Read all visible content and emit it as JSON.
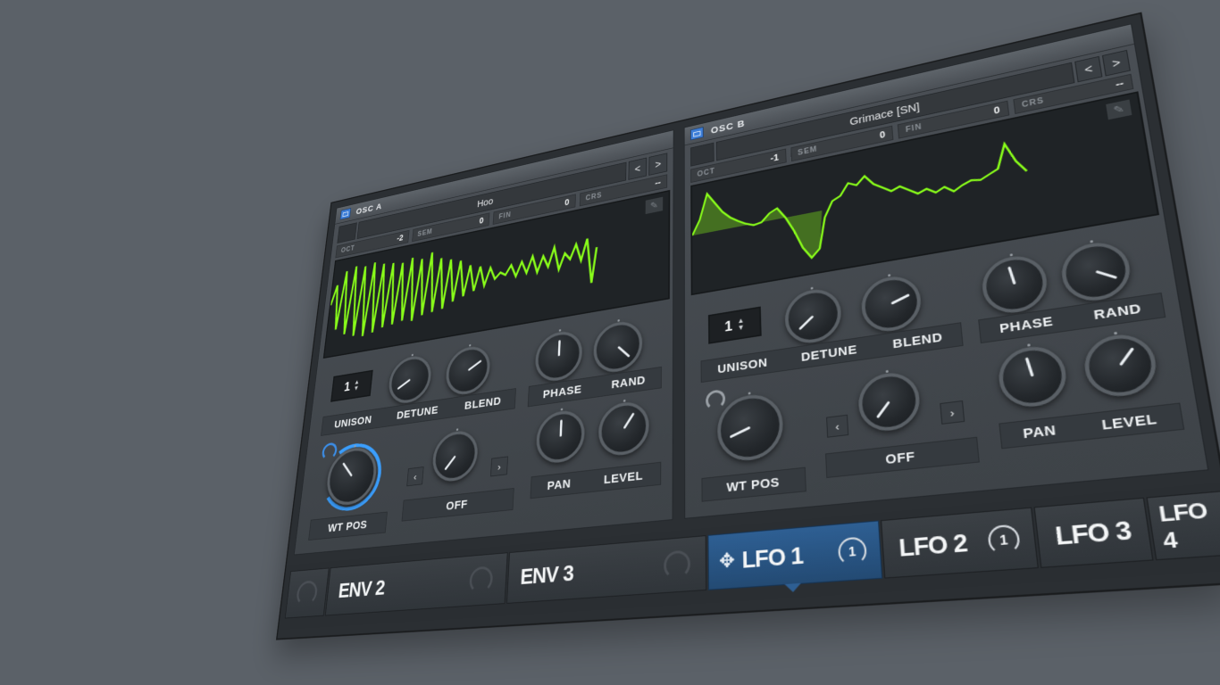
{
  "osc_a": {
    "title": "OSC  A",
    "wavetable": "Hoo",
    "prev": "<",
    "next": ">",
    "params": [
      {
        "key": "OCT",
        "value": "-2"
      },
      {
        "key": "SEM",
        "value": "0"
      },
      {
        "key": "FIN",
        "value": "0"
      },
      {
        "key": "CRS",
        "value": "--"
      }
    ],
    "unison_value": "1",
    "labels_left": [
      "UNISON",
      "DETUNE",
      "BLEND"
    ],
    "labels_right": [
      "PHASE",
      "RAND"
    ],
    "wt_pos": "WT POS",
    "off": "OFF",
    "pan": "PAN",
    "level": "LEVEL"
  },
  "osc_b": {
    "title": "OSC  B",
    "wavetable": "Grimace [SN]",
    "prev": "<",
    "next": ">",
    "params": [
      {
        "key": "OCT",
        "value": "-1"
      },
      {
        "key": "SEM",
        "value": "0"
      },
      {
        "key": "FIN",
        "value": "0"
      },
      {
        "key": "CRS",
        "value": "--"
      }
    ],
    "unison_value": "1",
    "labels_left": [
      "UNISON",
      "DETUNE",
      "BLEND"
    ],
    "labels_right": [
      "PHASE",
      "RAND"
    ],
    "wt_pos": "WT POS",
    "off": "OFF",
    "pan": "PAN",
    "level": "LEVEL"
  },
  "tabs": [
    {
      "label": "ENV 2",
      "count": ""
    },
    {
      "label": "ENV 3",
      "count": ""
    },
    {
      "label": "LFO 1",
      "count": "1",
      "active": true
    },
    {
      "label": "LFO 2",
      "count": "1"
    },
    {
      "label": "LFO 3",
      "count": ""
    },
    {
      "label": "LFO 4",
      "count": ""
    }
  ],
  "colors": {
    "accent_blue": "#3ca0ff",
    "waveform_green": "#8aff1a",
    "panel": "#44494e"
  },
  "icons": {
    "pencil": "pencil-icon",
    "move": "move-icon",
    "toggle": "osc-toggle-icon"
  }
}
